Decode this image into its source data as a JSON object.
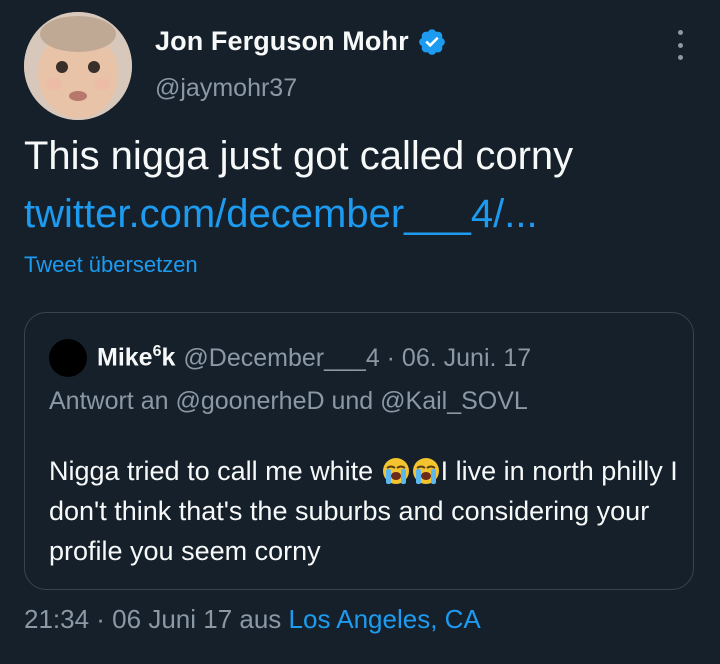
{
  "author": {
    "display_name": "Jon Ferguson Mohr",
    "handle": "@jaymohr37"
  },
  "tweet": {
    "text": "This nigga just got called corny",
    "link": "twitter.com/december___4/...",
    "translate_label": "Tweet übersetzen"
  },
  "quoted": {
    "name": "Mike",
    "name_sup": "6",
    "name_suffix": "k",
    "handle_date": "@December___4 · 06. Juni. 17",
    "reply_to": "Antwort an @goonerheD und @Kail_SOVL",
    "body_part1": "Nigga tried to call me white ",
    "body_part2": "I live in north philly I don't think that's the suburbs and considering your profile you seem corny",
    "emojis": [
      "loudly-crying-face",
      "loudly-crying-face"
    ]
  },
  "meta": {
    "time_date": "21:34 · 06 Juni 17 aus ",
    "location": "Los Angeles, CA"
  },
  "colors": {
    "background": "#15202b",
    "link": "#1d9bf0",
    "secondary": "#8b98a5",
    "border": "#38444d"
  }
}
